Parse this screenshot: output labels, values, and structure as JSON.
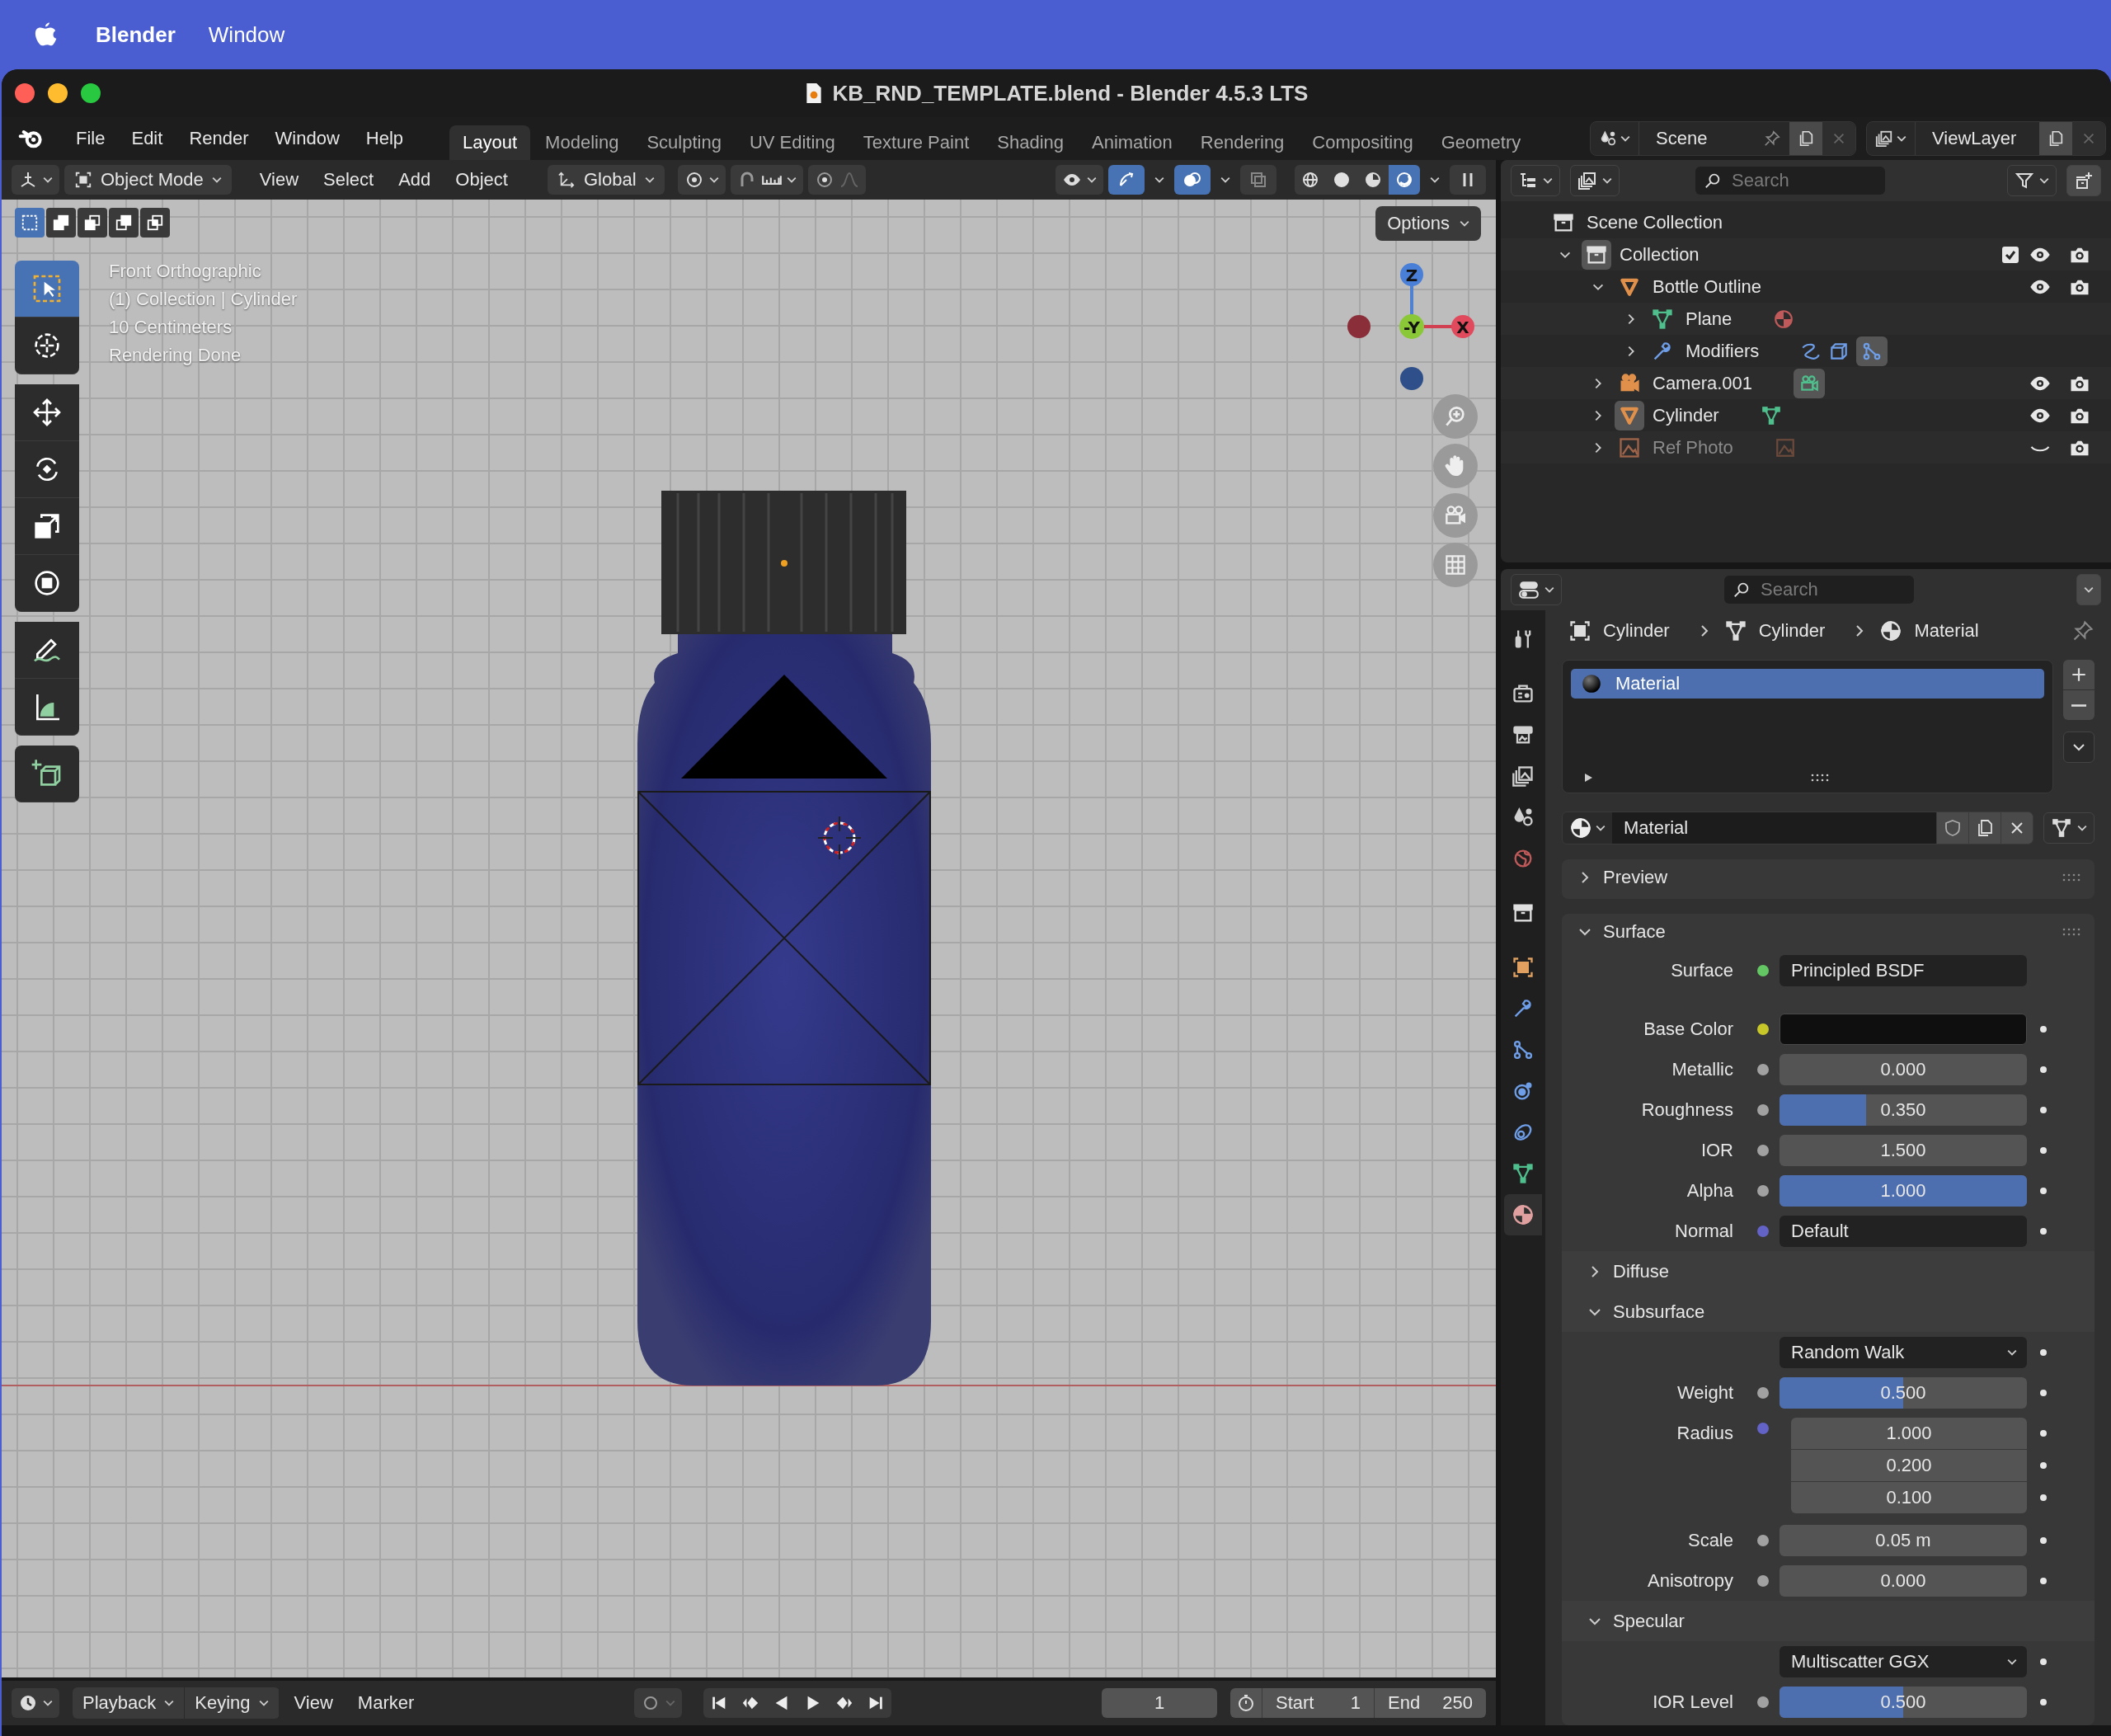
{
  "menubar": {
    "app": "Blender",
    "items": [
      "Window"
    ]
  },
  "window": {
    "title": "KB_RND_TEMPLATE.blend - Blender 4.5.3 LTS"
  },
  "topbar": {
    "menus": [
      "File",
      "Edit",
      "Render",
      "Window",
      "Help"
    ],
    "workspaces": [
      {
        "label": "Layout",
        "selected": true
      },
      {
        "label": "Modeling",
        "selected": false
      },
      {
        "label": "Sculpting",
        "selected": false
      },
      {
        "label": "UV Editing",
        "selected": false
      },
      {
        "label": "Texture Paint",
        "selected": false
      },
      {
        "label": "Shading",
        "selected": false
      },
      {
        "label": "Animation",
        "selected": false
      },
      {
        "label": "Rendering",
        "selected": false
      },
      {
        "label": "Compositing",
        "selected": false
      },
      {
        "label": "Geometry",
        "selected": false
      }
    ],
    "scene": "Scene",
    "view_layer": "ViewLayer"
  },
  "viewport": {
    "mode": "Object Mode",
    "menus": [
      "View",
      "Select",
      "Add",
      "Object"
    ],
    "orientation": "Global",
    "toggles": [
      {
        "kind": "gizmo",
        "on": true
      },
      {
        "kind": "overlay",
        "on": true
      },
      {
        "kind": "xray",
        "on": false
      }
    ],
    "shading": [
      {
        "kind": "wireframe",
        "selected": false
      },
      {
        "kind": "solid",
        "selected": false
      },
      {
        "kind": "material",
        "selected": false
      },
      {
        "kind": "rendered",
        "selected": true
      }
    ],
    "select_modes": [
      {
        "kind": "new",
        "selected": true
      },
      {
        "kind": "extend",
        "selected": false
      },
      {
        "kind": "subtract",
        "selected": false
      },
      {
        "kind": "difference",
        "selected": false
      },
      {
        "kind": "intersect",
        "selected": false
      }
    ],
    "options": "Options",
    "overlay_lines": [
      "Front Orthographic",
      "(1) Collection | Cylinder",
      "10 Centimeters",
      "Rendering Done"
    ],
    "tools": [
      {
        "kind": "select",
        "selected": true
      },
      {
        "kind": "cursor",
        "selected": false
      },
      {
        "kind": "move",
        "selected": false
      },
      {
        "kind": "rotate",
        "selected": false
      },
      {
        "kind": "scale",
        "selected": false
      },
      {
        "kind": "transform",
        "selected": false
      },
      {
        "kind": "annotate",
        "selected": false
      },
      {
        "kind": "measure",
        "selected": false
      },
      {
        "kind": "add_cube",
        "selected": false
      }
    ],
    "gizmo": {
      "z": "Z",
      "y": "-Y",
      "x": "X"
    }
  },
  "outliner": {
    "search_placeholder": "Search",
    "tree": [
      {
        "name": "Scene Collection",
        "kind": "collection",
        "active": false,
        "children": [
          {
            "name": "Collection",
            "kind": "collection",
            "active": true,
            "expanded": true,
            "checked": true,
            "visible": true,
            "children": [
              {
                "name": "Bottle Outline",
                "kind": "mesh_object",
                "active": false,
                "expanded": true,
                "visible": true,
                "children": [
                  {
                    "name": "Plane",
                    "kind": "mesh",
                    "active": false,
                    "expanded": false
                  },
                  {
                    "name": "Modifiers",
                    "kind": "modifiers",
                    "active": false,
                    "expanded": false
                  }
                ]
              },
              {
                "name": "Camera.001",
                "kind": "camera",
                "active": false,
                "expanded": false,
                "visible": true
              },
              {
                "name": "Cylinder",
                "kind": "mesh_object",
                "active": true,
                "expanded": false,
                "visible": true
              },
              {
                "name": "Ref Photo",
                "kind": "image",
                "active": false,
                "expanded": false,
                "visible": false
              }
            ]
          }
        ]
      }
    ]
  },
  "properties": {
    "search_placeholder": "Search",
    "tabs": [
      {
        "kind": "tool",
        "selected": false
      },
      {
        "kind": "render",
        "selected": false
      },
      {
        "kind": "output",
        "selected": false
      },
      {
        "kind": "view_layer",
        "selected": false
      },
      {
        "kind": "scene",
        "selected": false
      },
      {
        "kind": "world",
        "selected": false
      },
      {
        "kind": "collection",
        "selected": false
      },
      {
        "kind": "object",
        "selected": false
      },
      {
        "kind": "modifiers",
        "selected": false
      },
      {
        "kind": "particles",
        "selected": false
      },
      {
        "kind": "physics",
        "selected": false
      },
      {
        "kind": "constraints",
        "selected": false
      },
      {
        "kind": "data",
        "selected": false
      },
      {
        "kind": "material",
        "selected": true
      }
    ],
    "breadcrumb": [
      {
        "kind": "object",
        "label": "Cylinder"
      },
      {
        "kind": "data",
        "label": "Cylinder"
      },
      {
        "kind": "material",
        "label": "Material"
      }
    ],
    "slots": [
      {
        "name": "Material",
        "selected": true
      }
    ],
    "material": "Material",
    "panels": [
      {
        "title": "Preview",
        "expanded": false
      },
      {
        "title": "Surface",
        "expanded": true,
        "items": [
          {
            "kind": "link",
            "label": "Surface",
            "color": "#63c763",
            "value": "Principled BSDF"
          },
          {
            "kind": "swatch",
            "label": "Base Color",
            "color": "#c7c729"
          },
          {
            "kind": "slider",
            "label": "Metallic",
            "color": "#a1a1a1",
            "value": "0.000",
            "level": 0
          },
          {
            "kind": "slider",
            "label": "Roughness",
            "color": "#a1a1a1",
            "value": "0.350",
            "level": 0.35
          },
          {
            "kind": "number",
            "label": "IOR",
            "color": "#a1a1a1",
            "value": "1.500"
          },
          {
            "kind": "slider",
            "label": "Alpha",
            "color": "#a1a1a1",
            "value": "1.000",
            "level": 1
          },
          {
            "kind": "link",
            "label": "Normal",
            "color": "#6363c7",
            "value": "Default"
          },
          {
            "kind": "subpanel",
            "label": "Diffuse",
            "expanded": false
          },
          {
            "kind": "subpanel",
            "label": "Subsurface",
            "expanded": true
          },
          {
            "kind": "dropdown",
            "value": "Random Walk"
          },
          {
            "kind": "slider",
            "label": "Weight",
            "color": "#a1a1a1",
            "value": "0.500",
            "level": 0.5
          },
          {
            "kind": "vector",
            "label": "Radius",
            "color": "#6363c7",
            "values": [
              "1.000",
              "0.200",
              "0.100"
            ]
          },
          {
            "kind": "number",
            "label": "Scale",
            "color": "#a1a1a1",
            "value": "0.05 m"
          },
          {
            "kind": "slider",
            "label": "Anisotropy",
            "color": "#a1a1a1",
            "value": "0.000",
            "level": 0
          },
          {
            "kind": "subpanel",
            "label": "Specular",
            "expanded": true
          },
          {
            "kind": "dropdown",
            "value": "Multiscatter GGX"
          },
          {
            "kind": "slider",
            "label": "IOR Level",
            "color": "#a1a1a1",
            "value": "0.500",
            "level": 0.5
          }
        ]
      }
    ]
  },
  "timeline": {
    "dropdown_menus": [
      "Playback",
      "Keying"
    ],
    "menus": [
      "View",
      "Marker"
    ],
    "frame": "1",
    "start_label": "Start",
    "start": "1",
    "end_label": "End",
    "end": "250"
  }
}
